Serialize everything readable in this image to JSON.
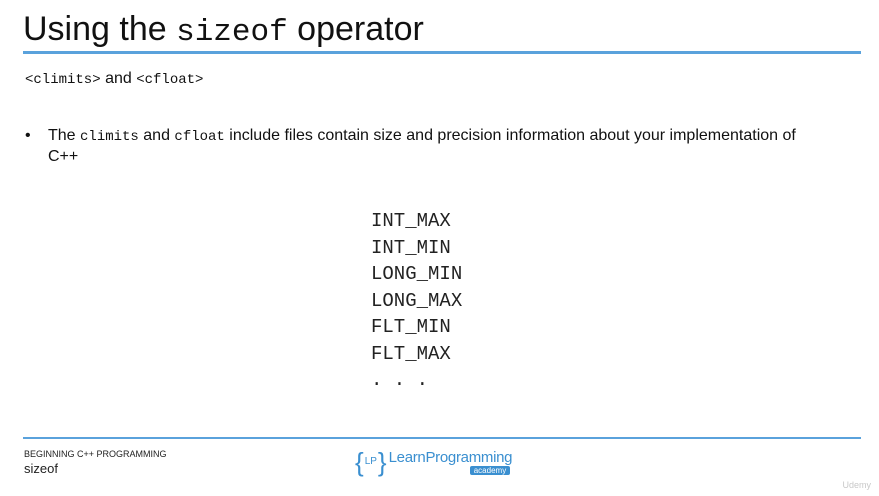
{
  "slide": {
    "title_prefix": "Using the ",
    "title_code": "sizeof",
    "title_suffix": " operator",
    "subtitle_code1": "<climits>",
    "subtitle_and": " and ",
    "subtitle_code2": "<cfloat>",
    "bullet": {
      "marker": "•",
      "part1": "The ",
      "code1": "climits",
      "part2": " and ",
      "code2": "cfloat",
      "part3": " include files contain size and precision information about your implementation of C++"
    },
    "macros": [
      "INT_MAX",
      "INT_MIN",
      "LONG_MIN",
      "LONG_MAX",
      "FLT_MIN",
      "FLT_MAX",
      ". . ."
    ]
  },
  "footer": {
    "course": "BEGINNING C++ PROGRAMMING",
    "topic": "sizeof",
    "logo": {
      "brace_open": "{",
      "initials": "LP",
      "brace_close": "}",
      "name": "LearnProgramming",
      "tagline": "academy"
    }
  },
  "watermark": "Udemy",
  "colors": {
    "accent": "#5aa2dc",
    "logo": "#3a8fd0"
  }
}
